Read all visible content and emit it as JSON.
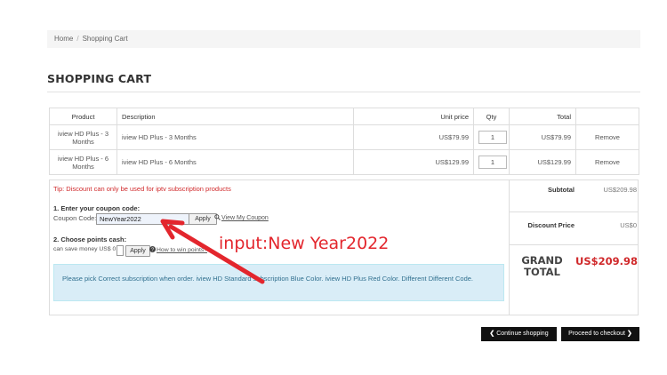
{
  "breadcrumb": {
    "home": "Home",
    "separator": "/",
    "current": "Shopping Cart"
  },
  "page_title": "SHOPPING CART",
  "table": {
    "headers": {
      "product": "Product",
      "description": "Description",
      "unit_price": "Unit price",
      "qty": "Qty",
      "total": "Total"
    },
    "rows": [
      {
        "product": "iview HD Plus - 3 Months",
        "description": "iview HD Plus - 3 Months",
        "unit_price": "US$79.99",
        "qty": "1",
        "total": "US$79.99",
        "action": "Remove"
      },
      {
        "product": "iview HD Plus - 6 Months",
        "description": "iview HD Plus - 6 Months",
        "unit_price": "US$129.99",
        "qty": "1",
        "total": "US$129.99",
        "action": "Remove"
      }
    ]
  },
  "tip": "Tip: Discount can only be used for iptv subscription products",
  "coupon": {
    "heading": "1. Enter your coupon code:",
    "label": "Coupon Code:",
    "value": "NewYear2022",
    "apply": "Apply",
    "view_link": "View My Coupon"
  },
  "points": {
    "heading": "2. Choose points cash:",
    "text": "can save money US$ 0",
    "value": "",
    "apply": "Apply",
    "how_link": "How to win points?"
  },
  "notice": "Please pick Correct subscription when order. iview HD Standard subscription Blue Color. iview HD Plus Red Color. Different Different Code.",
  "summary": {
    "subtotal_label": "Subtotal",
    "subtotal_value": "US$209.98",
    "discount_label": "Discount Price",
    "discount_value": "US$0",
    "grand_label_1": "GRAND",
    "grand_label_2": "TOTAL",
    "grand_value": "US$209.98"
  },
  "buttons": {
    "continue": "Continue shopping",
    "checkout": "Proceed to checkout"
  },
  "annotation": {
    "text": "input:New Year2022",
    "color": "#e3262d"
  }
}
